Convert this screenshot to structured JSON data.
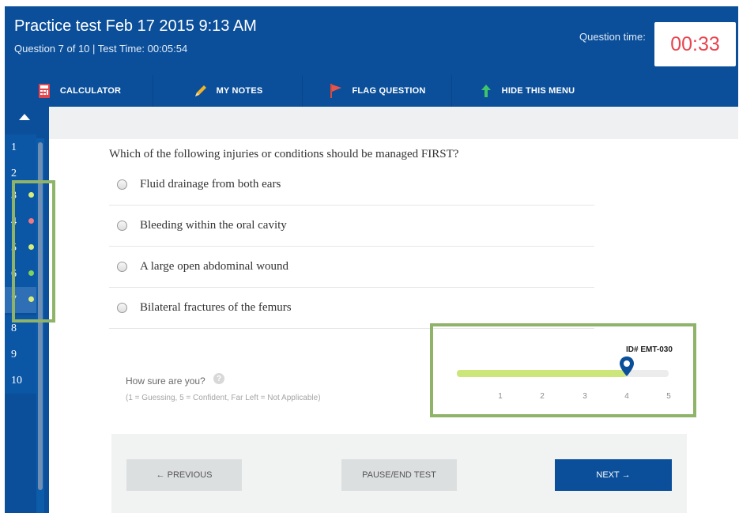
{
  "header": {
    "title": "Practice test Feb 17 2015 9:13 AM",
    "subtitle": "Question 7 of 10 | Test Time: 00:05:54",
    "question_time_label": "Question time:",
    "question_time_value": "00:33"
  },
  "menu": {
    "items": [
      {
        "label": "CALCULATOR",
        "icon": "calculator-icon"
      },
      {
        "label": "MY NOTES",
        "icon": "pencil-icon"
      },
      {
        "label": "FLAG QUESTION",
        "icon": "flag-icon"
      },
      {
        "label": "HIDE THIS MENU",
        "icon": "arrow-up-icon"
      }
    ]
  },
  "sidebar": {
    "questions": [
      {
        "num": "1",
        "status": "none"
      },
      {
        "num": "2",
        "status": "none"
      },
      {
        "num": "3",
        "status": "answered"
      },
      {
        "num": "4",
        "status": "flagged"
      },
      {
        "num": "5",
        "status": "answered"
      },
      {
        "num": "6",
        "status": "answered"
      },
      {
        "num": "7",
        "status": "answered"
      },
      {
        "num": "8",
        "status": "none"
      },
      {
        "num": "9",
        "status": "none"
      },
      {
        "num": "10",
        "status": "none"
      }
    ],
    "colors": {
      "answered": "#d9ee7a",
      "flagged": "#f07a84",
      "active_green": "#7fd35a"
    }
  },
  "question": {
    "text": "Which of the following injuries or conditions should be managed FIRST?",
    "options": [
      "Fluid drainage from both ears",
      "Bleeding within the oral cavity",
      "A large open abdominal wound",
      "Bilateral fractures of the femurs"
    ],
    "selected_index": null
  },
  "confidence": {
    "label": "How sure are you?",
    "help_glyph": "?",
    "hint": "(1 = Guessing, 5 = Confident, Far Left = Not Applicable)",
    "id_label": "ID# EMT-030",
    "scale": [
      "1",
      "2",
      "3",
      "4",
      "5"
    ],
    "value": 4,
    "min": 0,
    "max": 5
  },
  "buttons": {
    "previous": "← PREVIOUS",
    "pause": "PAUSE/END TEST",
    "next": "NEXT →"
  },
  "colors": {
    "brand_blue": "#0b4f9a",
    "timer_red": "#e8434e",
    "highlight_green": "#8fb369",
    "slider_fill": "#cde67a"
  }
}
